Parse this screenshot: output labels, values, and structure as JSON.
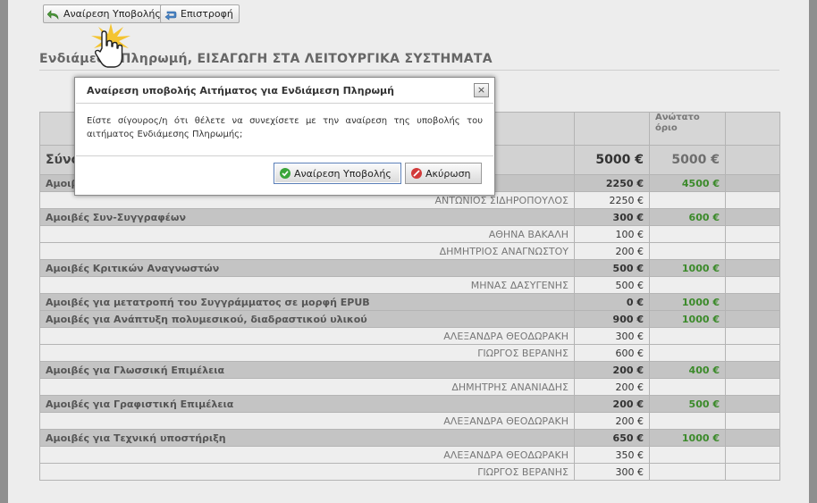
{
  "toolbar": {
    "remove_submission_label": "Αναίρεση Υποβολής",
    "back_label": "Επιστροφή"
  },
  "page_title": "Ενδιάμεση Πληρωμή, ΕΙΣΑΓΩΓΗ ΣΤΑ ΛΕΙΤΟΥΡΓΙΚΑ ΣΥΣΤΗΜΑΤΑ",
  "table": {
    "header_max": "Ανώτατο όριο",
    "total": {
      "label": "Σύνολο",
      "amount": "5000 €",
      "max": "5000 €"
    },
    "rows": [
      {
        "type": "cat",
        "label": "Αμοιβές Συγγραφέων",
        "amount": "2250 €",
        "max": "4500 €"
      },
      {
        "type": "person",
        "label": "ΑΝΤΩΝΙΟΣ ΣΙΔΗΡΟΠΟΥΛΟΣ",
        "amount": "2250 €",
        "max": ""
      },
      {
        "type": "cat",
        "label": "Αμοιβές Συν-Συγγραφέων",
        "amount": "300 €",
        "max": "600 €"
      },
      {
        "type": "person",
        "label": "ΑΘΗΝΑ ΒΑΚΑΛΗ",
        "amount": "100 €",
        "max": ""
      },
      {
        "type": "person",
        "label": "ΔΗΜΗΤΡΙΟΣ ΑΝΑΓΝΩΣΤΟΥ",
        "amount": "200 €",
        "max": ""
      },
      {
        "type": "cat",
        "label": "Αμοιβές Κριτικών Αναγνωστών",
        "amount": "500 €",
        "max": "1000 €"
      },
      {
        "type": "person",
        "label": "ΜΗΝΑΣ ΔΑΣΥΓΕΝΗΣ",
        "amount": "500 €",
        "max": ""
      },
      {
        "type": "cat",
        "label": "Αμοιβές για μετατροπή του Συγγράμματος σε μορφή EPUB",
        "amount": "0 €",
        "max": "1000 €"
      },
      {
        "type": "cat",
        "label": "Αμοιβές για Ανάπτυξη πολυμεσικού, διαδραστικού υλικού",
        "amount": "900 €",
        "max": "1000 €"
      },
      {
        "type": "person",
        "label": "ΑΛΕΞΑΝΔΡΑ ΘΕΟΔΩΡΑΚΗ",
        "amount": "300 €",
        "max": ""
      },
      {
        "type": "person",
        "label": "ΓΙΩΡΓΟΣ ΒΕΡΑΝΗΣ",
        "amount": "600 €",
        "max": ""
      },
      {
        "type": "cat",
        "label": "Αμοιβές για Γλωσσική Επιμέλεια",
        "amount": "200 €",
        "max": "400 €"
      },
      {
        "type": "person",
        "label": "ΔΗΜΗΤΡΗΣ ΑΝΑΝΙΑΔΗΣ",
        "amount": "200 €",
        "max": ""
      },
      {
        "type": "cat",
        "label": "Αμοιβές για Γραφιστική Επιμέλεια",
        "amount": "200 €",
        "max": "500 €"
      },
      {
        "type": "person",
        "label": "ΑΛΕΞΑΝΔΡΑ ΘΕΟΔΩΡΑΚΗ",
        "amount": "200 €",
        "max": ""
      },
      {
        "type": "cat",
        "label": "Αμοιβές για Τεχνική υποστήριξη",
        "amount": "650 €",
        "max": "1000 €"
      },
      {
        "type": "person",
        "label": "ΑΛΕΞΑΝΔΡΑ ΘΕΟΔΩΡΑΚΗ",
        "amount": "350 €",
        "max": ""
      },
      {
        "type": "person",
        "label": "ΓΙΩΡΓΟΣ ΒΕΡΑΝΗΣ",
        "amount": "300 €",
        "max": ""
      }
    ]
  },
  "dialog": {
    "title": "Αναίρεση υποβολής Αιτήματος για Ενδιάμεση Πληρωμή",
    "close_label": "×",
    "message": "Είστε σίγουρος/η ότι θέλετε να συνεχίσετε με την αναίρεση της υποβολής του αιτήματος Ενδιάμεσης Πληρωμής;",
    "confirm_label": "Αναίρεση Υποβολής",
    "cancel_label": "Ακύρωση"
  },
  "colors": {
    "max_value": "#3b8a2a",
    "confirm_icon": "#3aa53a",
    "cancel_icon": "#d23b3b",
    "confirm_border": "#5a7fb8"
  },
  "icons": {
    "remove_submission": "undo-arrow-icon",
    "back": "return-arrow-icon",
    "confirm": "check-circle-icon",
    "cancel": "no-entry-icon",
    "cursor": "hand-pointer-icon"
  }
}
